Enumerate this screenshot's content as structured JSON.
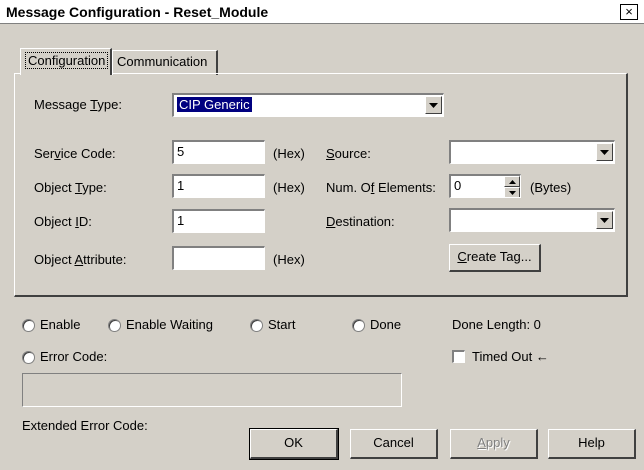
{
  "window": {
    "title": "Message Configuration - Reset_Module",
    "close_glyph": "×"
  },
  "tabs": [
    {
      "label": "Configuration"
    },
    {
      "label": "Communication"
    }
  ],
  "config": {
    "message_type": {
      "label_pre": "Message ",
      "label_u": "T",
      "label_post": "ype:",
      "value": "CIP Generic"
    },
    "service_code": {
      "label_pre": "Ser",
      "label_u": "v",
      "label_post": "ice Code:",
      "value": "5",
      "unit": "(Hex)"
    },
    "object_type": {
      "label_pre": "Object ",
      "label_u": "T",
      "label_post": "ype:",
      "value": "1",
      "unit": "(Hex)"
    },
    "object_id": {
      "label_pre": "Object ",
      "label_u": "I",
      "label_post": "D:",
      "value": "1"
    },
    "object_attribute": {
      "label_pre": "Object ",
      "label_u": "A",
      "label_post": "ttribute:",
      "value": "",
      "unit": "(Hex)"
    },
    "source": {
      "label_u": "S",
      "label_post": "ource:",
      "value": ""
    },
    "num_elements": {
      "label_pre": "Num. O",
      "label_u": "f",
      "label_post": " Elements:",
      "value": "0",
      "unit": "(Bytes)"
    },
    "destination": {
      "label_u": "D",
      "label_post": "estination:",
      "value": ""
    },
    "create_tag": {
      "label_u": "C",
      "label_post": "reate Tag..."
    }
  },
  "status": {
    "enable": "Enable",
    "enable_waiting": "Enable Waiting",
    "start": "Start",
    "done": "Done",
    "done_length": "Done Length: 0",
    "error_code": "Error Code:",
    "timed_out": "Timed Out",
    "timed_out_arrow": "←",
    "extended_error_code": "Extended Error Code:"
  },
  "buttons": {
    "ok": "OK",
    "cancel": "Cancel",
    "apply_u": "A",
    "apply_post": "pply",
    "help": "Help"
  }
}
